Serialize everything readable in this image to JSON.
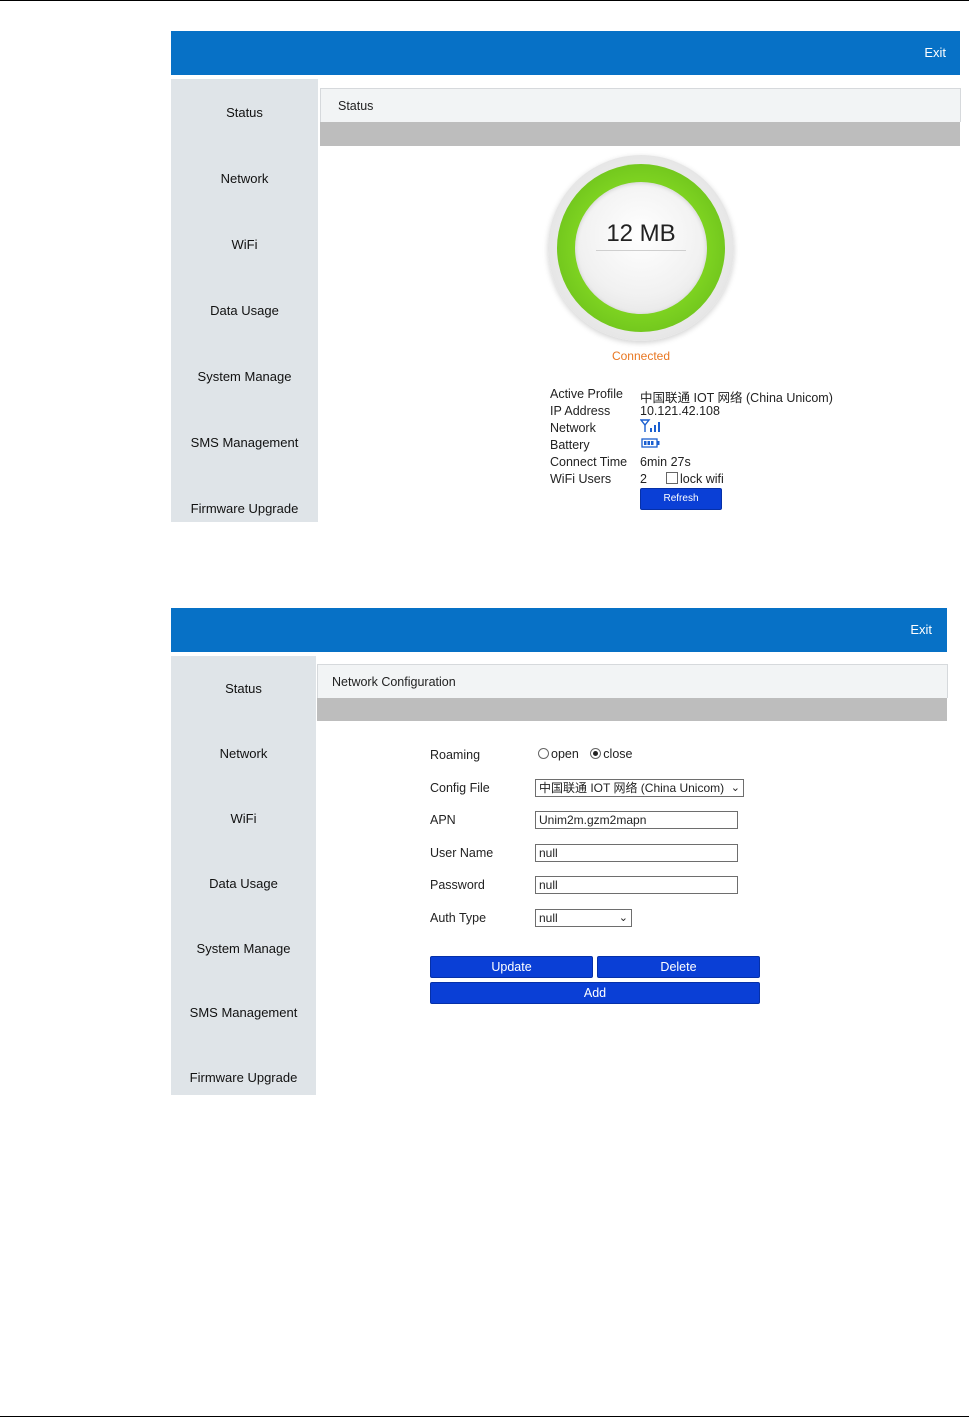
{
  "status_panel": {
    "exit_label": "Exit",
    "sidebar": [
      "Status",
      "Network",
      "WiFi",
      "Data Usage",
      "System Manage",
      "SMS Management",
      "Firmware Upgrade"
    ],
    "header_title": "Status",
    "usage": "12 MB",
    "connection_status": "Connected",
    "info": {
      "active_profile_label": "Active Profile",
      "active_profile_value": "中国联通 IOT 网络 (China Unicom)",
      "ip_label": "IP Address",
      "ip_value": "10.121.42.108",
      "network_label": "Network",
      "battery_label": "Battery",
      "connect_time_label": "Connect Time",
      "connect_time_value": "6min 27s",
      "wifi_users_label": "WiFi Users",
      "wifi_users_value": "2",
      "lock_wifi_label": "lock wifi"
    },
    "refresh_label": "Refresh",
    "colors": {
      "topbar": "#0771c6",
      "ring": "#7ed321",
      "connected": "#e87722",
      "button": "#0a3fd6"
    }
  },
  "network_panel": {
    "exit_label": "Exit",
    "sidebar": [
      "Status",
      "Network",
      "WiFi",
      "Data Usage",
      "System Manage",
      "SMS Management",
      "Firmware Upgrade"
    ],
    "header_title": "Network Configuration",
    "form": {
      "roaming_label": "Roaming",
      "roaming_open": "open",
      "roaming_close": "close",
      "roaming_selected": "close",
      "config_file_label": "Config File",
      "config_file_value": "中国联通 IOT 网络 (China Unicom)",
      "apn_label": "APN",
      "apn_value": "Unim2m.gzm2mapn",
      "username_label": "User Name",
      "username_value": "null",
      "password_label": "Password",
      "password_value": "null",
      "auth_type_label": "Auth Type",
      "auth_type_value": "null"
    },
    "update_label": "Update",
    "delete_label": "Delete",
    "add_label": "Add"
  }
}
